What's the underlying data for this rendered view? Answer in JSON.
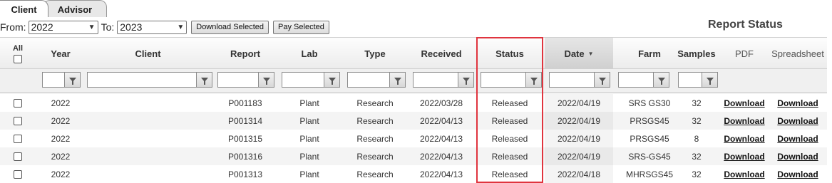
{
  "tabs": [
    {
      "label": "Client"
    },
    {
      "label": "Advisor"
    }
  ],
  "filters": {
    "from_label": "From:",
    "from_value": "2022",
    "to_label": "To:",
    "to_value": "2023",
    "download_selected": "Download Selected",
    "pay_selected": "Pay Selected"
  },
  "title": "Report Status",
  "columns": {
    "all": "All",
    "year": "Year",
    "client": "Client",
    "report": "Report",
    "lab": "Lab",
    "type": "Type",
    "received": "Received",
    "status": "Status",
    "date": "Date",
    "farm": "Farm",
    "samples": "Samples",
    "pdf": "PDF",
    "spreadsheet": "Spreadsheet"
  },
  "rows": [
    {
      "year": "2022",
      "client": "",
      "report": "P001183",
      "lab": "Plant",
      "type": "Research",
      "received": "2022/03/28",
      "status": "Released",
      "date": "2022/04/19",
      "farm": "SRS GS30",
      "samples": "32",
      "pdf": "Download",
      "spreadsheet": "Download"
    },
    {
      "year": "2022",
      "client": "",
      "report": "P001314",
      "lab": "Plant",
      "type": "Research",
      "received": "2022/04/13",
      "status": "Released",
      "date": "2022/04/19",
      "farm": "PRSGS45",
      "samples": "32",
      "pdf": "Download",
      "spreadsheet": "Download"
    },
    {
      "year": "2022",
      "client": "",
      "report": "P001315",
      "lab": "Plant",
      "type": "Research",
      "received": "2022/04/13",
      "status": "Released",
      "date": "2022/04/19",
      "farm": "PRSGS45",
      "samples": "8",
      "pdf": "Download",
      "spreadsheet": "Download"
    },
    {
      "year": "2022",
      "client": "",
      "report": "P001316",
      "lab": "Plant",
      "type": "Research",
      "received": "2022/04/13",
      "status": "Released",
      "date": "2022/04/19",
      "farm": "SRS-GS45",
      "samples": "32",
      "pdf": "Download",
      "spreadsheet": "Download"
    },
    {
      "year": "2022",
      "client": "",
      "report": "P001313",
      "lab": "Plant",
      "type": "Research",
      "received": "2022/04/13",
      "status": "Released",
      "date": "2022/04/18",
      "farm": "MHRSGS45",
      "samples": "32",
      "pdf": "Download",
      "spreadsheet": "Download"
    }
  ],
  "highlight_color": "#e0343e"
}
